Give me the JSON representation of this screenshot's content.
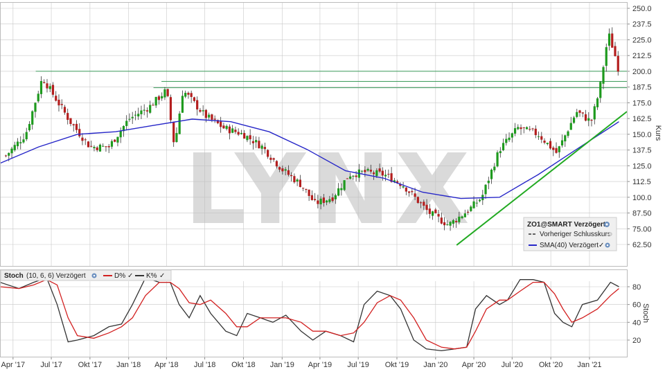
{
  "watermark": "LYNX",
  "price_panel": {
    "axis_title": "Kurs",
    "y_ticks": [
      "250.0",
      "237.5",
      "225.0",
      "212.5",
      "200.0",
      "187.5",
      "175.0",
      "162.5",
      "150.0",
      "137.5",
      "125.0",
      "112.5",
      "100.0",
      "87.50",
      "75.00",
      "62.50"
    ],
    "legend": {
      "title": "ZO1@SMART Verzögert",
      "previous_close": "Vorheriger Schlusskurs",
      "sma": "SMA(40) Verzögert"
    }
  },
  "stoch_panel": {
    "axis_title": "Stoch",
    "label": "Stoch",
    "params": "(10, 6, 6) Verzögert",
    "d_label": "D%",
    "k_label": "K%",
    "y_ticks": [
      "80",
      "60",
      "40",
      "20"
    ]
  },
  "x_axis": {
    "labels": [
      "Apr '17",
      "Jul '17",
      "Okt '17",
      "Jan '18",
      "Apr '18",
      "Jul '18",
      "Okt '18",
      "Jan '19",
      "Apr '19",
      "Jul '19",
      "Okt '19",
      "Jan '20",
      "Apr '20",
      "Jul '20",
      "Okt '20",
      "Jan '21"
    ]
  },
  "colors": {
    "up": "#1e9a1e",
    "down": "#b41e1e",
    "sma": "#2626c8",
    "trend": "#22aa22",
    "hline": "#3a9a5a",
    "d_line": "#d22020",
    "k_line": "#333333",
    "grid": "#c8c8c8"
  },
  "chart_data": [
    {
      "type": "line",
      "subtype": "weekly-ohlc-candles",
      "y_axis": "Kurs",
      "ylim": [
        50,
        252
      ],
      "grid": true,
      "legend_position": "bottom-right",
      "series": [
        {
          "name": "ZO1@SMART Verzögert",
          "description": "weekly close path (approx.)",
          "x": [
            "2017-03-15",
            "2017-05-01",
            "2017-06-10",
            "2017-08-15",
            "2017-10-01",
            "2017-11-15",
            "2018-01-01",
            "2018-02-20",
            "2018-04-01",
            "2018-04-20",
            "2018-05-10",
            "2018-07-01",
            "2018-08-15",
            "2018-10-01",
            "2018-11-15",
            "2019-01-01",
            "2019-02-15",
            "2019-03-20",
            "2019-05-01",
            "2019-06-10",
            "2019-07-15",
            "2019-09-01",
            "2019-10-15",
            "2019-12-15",
            "2020-02-01",
            "2020-03-20",
            "2020-04-20",
            "2020-06-01",
            "2020-07-15",
            "2020-09-01",
            "2020-10-15",
            "2020-12-01",
            "2021-01-05",
            "2021-01-25",
            "2021-02-15",
            "2021-03-01",
            "2021-03-12"
          ],
          "values": [
            133,
            150,
            195,
            160,
            140,
            140,
            162,
            172,
            185,
            140,
            185,
            165,
            155,
            150,
            140,
            122,
            110,
            95,
            100,
            118,
            120,
            118,
            110,
            88,
            78,
            90,
            100,
            138,
            155,
            150,
            135,
            168,
            160,
            185,
            230,
            215,
            200
          ]
        },
        {
          "name": "SMA(40) Verzögert",
          "x": [
            "2017-03-01",
            "2017-06-01",
            "2017-09-01",
            "2017-12-01",
            "2018-03-01",
            "2018-06-01",
            "2018-09-01",
            "2018-12-01",
            "2019-03-01",
            "2019-06-01",
            "2019-09-01",
            "2019-12-01",
            "2020-03-01",
            "2020-06-01",
            "2020-09-01",
            "2020-12-01",
            "2021-03-12"
          ],
          "values": [
            127,
            140,
            150,
            152,
            157,
            162,
            160,
            152,
            138,
            121,
            115,
            104,
            99,
            100,
            118,
            138,
            160
          ]
        }
      ],
      "horizontal_lines": [
        {
          "value": 200,
          "from": "2017-05-25"
        },
        {
          "value": 192,
          "from": "2018-03-20"
        },
        {
          "value": 187,
          "from": "2018-03-01"
        }
      ],
      "trendline": {
        "from": [
          "2020-02-20",
          62
        ],
        "to": [
          "2021-03-31",
          168
        ]
      }
    },
    {
      "type": "line",
      "y_axis": "Stoch",
      "ylim": [
        5,
        95
      ],
      "grid": true,
      "series": [
        {
          "name": "K%",
          "x": [
            "2017-03-01",
            "2017-04-15",
            "2017-05-20",
            "2017-06-20",
            "2017-07-15",
            "2017-08-10",
            "2017-09-01",
            "2017-10-10",
            "2017-11-15",
            "2017-12-15",
            "2018-01-10",
            "2018-02-10",
            "2018-03-15",
            "2018-04-10",
            "2018-05-01",
            "2018-05-25",
            "2018-06-20",
            "2018-07-15",
            "2018-08-20",
            "2018-09-15",
            "2018-10-10",
            "2018-11-10",
            "2018-12-10",
            "2019-01-10",
            "2019-02-15",
            "2019-03-15",
            "2019-04-15",
            "2019-05-20",
            "2019-06-20",
            "2019-07-15",
            "2019-08-15",
            "2019-09-15",
            "2019-10-10",
            "2019-11-10",
            "2019-12-10",
            "2020-01-15",
            "2020-02-15",
            "2020-03-15",
            "2020-04-05",
            "2020-05-01",
            "2020-06-01",
            "2020-06-20",
            "2020-07-20",
            "2020-08-20",
            "2020-09-15",
            "2020-10-10",
            "2020-10-30",
            "2020-11-20",
            "2020-12-15",
            "2021-01-20",
            "2021-02-20",
            "2021-03-12"
          ],
          "values": [
            85,
            78,
            85,
            90,
            60,
            18,
            20,
            25,
            35,
            38,
            60,
            90,
            85,
            85,
            60,
            45,
            70,
            50,
            30,
            25,
            50,
            45,
            40,
            48,
            30,
            20,
            30,
            25,
            18,
            60,
            75,
            70,
            55,
            20,
            10,
            8,
            10,
            12,
            55,
            70,
            60,
            65,
            88,
            88,
            85,
            50,
            40,
            35,
            60,
            65,
            85,
            80
          ]
        },
        {
          "name": "D%",
          "x": [
            "2017-03-01",
            "2017-04-15",
            "2017-05-20",
            "2017-06-20",
            "2017-07-15",
            "2017-08-10",
            "2017-09-01",
            "2017-10-10",
            "2017-11-15",
            "2017-12-15",
            "2018-01-10",
            "2018-02-10",
            "2018-03-15",
            "2018-04-10",
            "2018-05-01",
            "2018-05-25",
            "2018-06-20",
            "2018-07-15",
            "2018-08-20",
            "2018-09-15",
            "2018-10-10",
            "2018-11-10",
            "2018-12-10",
            "2019-01-10",
            "2019-02-15",
            "2019-03-15",
            "2019-04-15",
            "2019-05-20",
            "2019-06-20",
            "2019-07-15",
            "2019-08-15",
            "2019-09-15",
            "2019-10-10",
            "2019-11-10",
            "2019-12-10",
            "2020-01-15",
            "2020-02-15",
            "2020-03-15",
            "2020-04-05",
            "2020-05-01",
            "2020-06-01",
            "2020-06-20",
            "2020-07-20",
            "2020-08-20",
            "2020-09-15",
            "2020-10-10",
            "2020-10-30",
            "2020-11-20",
            "2020-12-15",
            "2021-01-20",
            "2021-02-20",
            "2021-03-12"
          ],
          "values": [
            80,
            78,
            82,
            88,
            82,
            45,
            25,
            22,
            28,
            35,
            45,
            70,
            85,
            85,
            78,
            62,
            60,
            65,
            50,
            35,
            35,
            45,
            45,
            45,
            40,
            30,
            30,
            25,
            28,
            40,
            62,
            70,
            65,
            45,
            20,
            12,
            10,
            12,
            30,
            55,
            65,
            65,
            75,
            85,
            85,
            72,
            55,
            40,
            45,
            55,
            70,
            78
          ]
        }
      ]
    }
  ]
}
